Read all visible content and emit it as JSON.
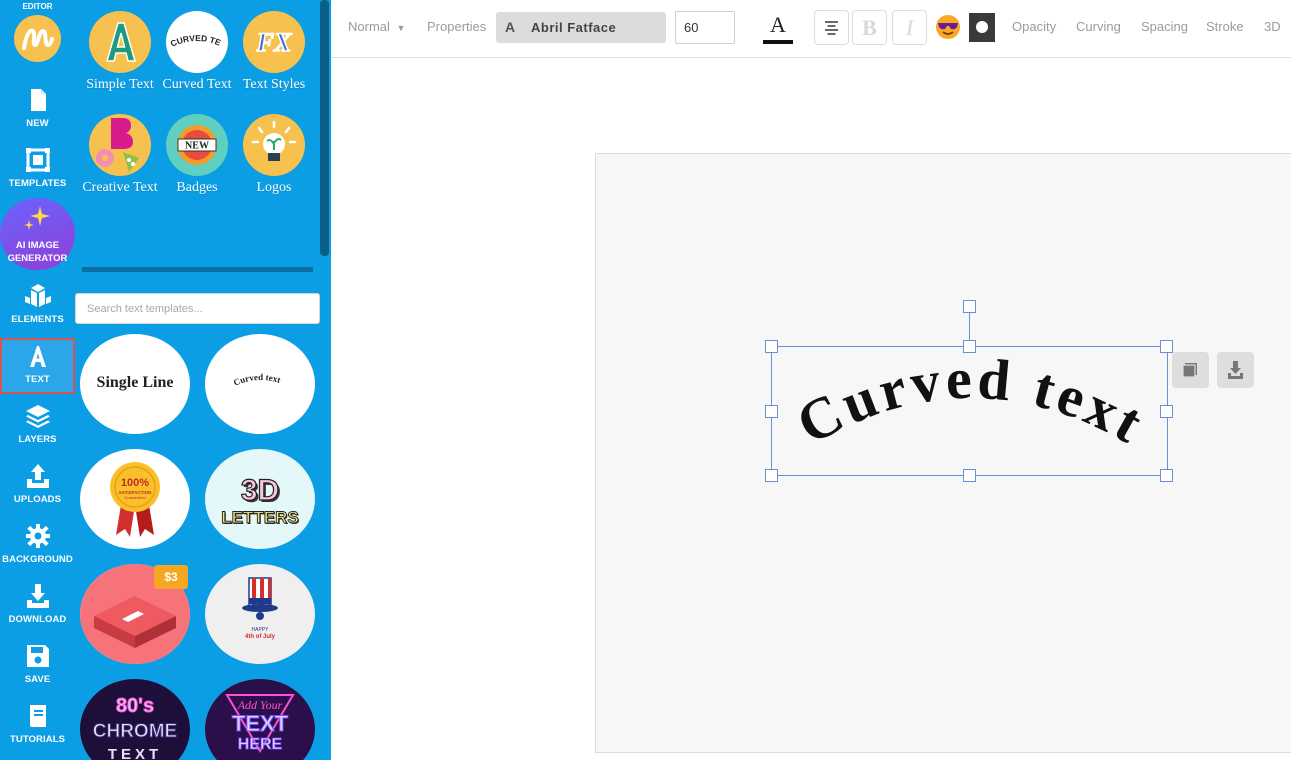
{
  "rail": {
    "top_label": "EDITOR",
    "items": [
      {
        "label": "NEW",
        "icon": "new-file-icon"
      },
      {
        "label": "TEMPLATES",
        "icon": "templates-icon"
      },
      {
        "label": "AI IMAGE GENERATOR",
        "icon": "sparkles-icon"
      },
      {
        "label": "ELEMENTS",
        "icon": "elements-icon"
      },
      {
        "label": "TEXT",
        "icon": "text-icon"
      },
      {
        "label": "LAYERS",
        "icon": "layers-icon"
      },
      {
        "label": "UPLOADS",
        "icon": "upload-icon"
      },
      {
        "label": "BACKGROUND",
        "icon": "gear-icon"
      },
      {
        "label": "DOWNLOAD",
        "icon": "download-icon"
      },
      {
        "label": "SAVE",
        "icon": "save-icon"
      },
      {
        "label": "TUTORIALS",
        "icon": "book-icon"
      }
    ],
    "active": "TEXT"
  },
  "panel": {
    "categories": [
      {
        "label": "Simple Text"
      },
      {
        "label": "Curved Text",
        "thumb_text": "CURVED TEXT"
      },
      {
        "label": "Text Styles",
        "thumb_text": "FX"
      },
      {
        "label": "Creative Text"
      },
      {
        "label": "Badges",
        "thumb_text": "NEW"
      },
      {
        "label": "Logos"
      }
    ],
    "search_placeholder": "Search text templates...",
    "templates": [
      {
        "name": "Single Line"
      },
      {
        "name": "Curved text"
      },
      {
        "name": "100% Satisfaction Guaranteed",
        "line1": "100%",
        "line2": "SATISFACTION",
        "line3": "Guaranteed"
      },
      {
        "name": "3D Letters",
        "line1": "3D",
        "line2": "LETTERS"
      },
      {
        "name": "Isometric box",
        "price": "$3"
      },
      {
        "name": "Happy 4th of July",
        "line1": "HAPPY",
        "line2": "4th of July"
      },
      {
        "name": "80's Chrome Text",
        "line1": "80's",
        "line2": "CHROME",
        "line3": "TEXT"
      },
      {
        "name": "Add Your Text Here",
        "line1": "Add Your",
        "line2": "TEXT",
        "line3": "HERE"
      }
    ]
  },
  "toolbar": {
    "mode": "Normal",
    "properties": "Properties",
    "font_icon": "A",
    "font_name": "Abril Fatface",
    "font_size": "60",
    "color_letter": "A",
    "bold": "B",
    "italic": "I",
    "opacity": "Opacity",
    "curving": "Curving",
    "spacing": "Spacing",
    "stroke": "Stroke",
    "three_d": "3D"
  },
  "canvas": {
    "text": "Curved text",
    "colors": {
      "accent": "#0c9ee4",
      "selection": "#6b8fd6",
      "text": "#111111"
    }
  }
}
